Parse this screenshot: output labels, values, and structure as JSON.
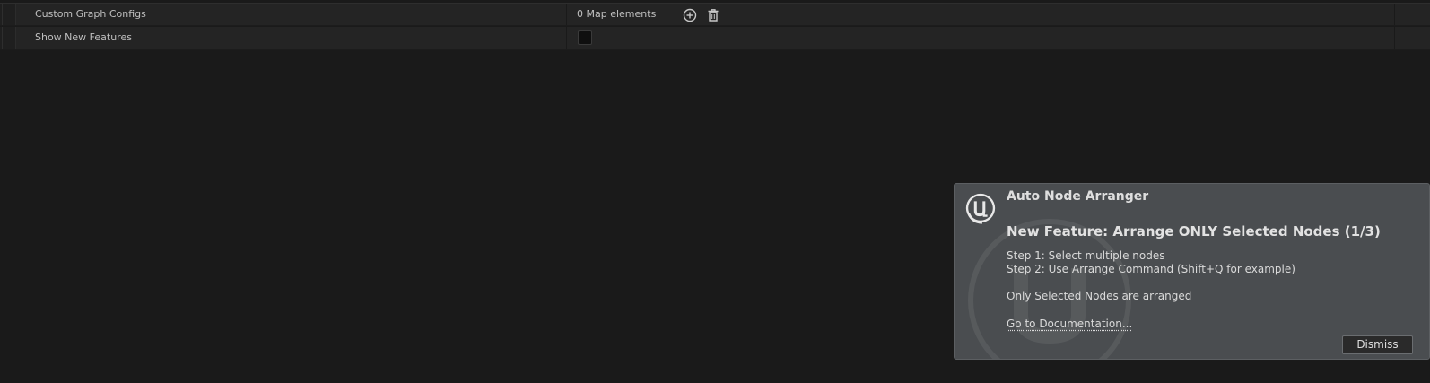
{
  "properties": {
    "rows": [
      {
        "label": "Custom Graph Configs",
        "value": "0 Map elements",
        "add_icon": "add-circle-icon",
        "delete_icon": "trash-icon"
      },
      {
        "label": "Show New Features",
        "checkbox_checked": false
      }
    ]
  },
  "notification": {
    "logo_icon": "unreal-engine-logo-icon",
    "title": "Auto Node Arranger",
    "heading": "New Feature: Arrange ONLY Selected Nodes (1/3)",
    "step1": "Step 1: Select multiple nodes",
    "step2": "Step 2: Use Arrange Command (Shift+Q for example)",
    "note": "Only Selected Nodes are arranged",
    "link": "Go to Documentation...",
    "dismiss_label": "Dismiss"
  },
  "colors": {
    "background": "#1a1a1a",
    "row_background": "#242424",
    "toast_background": "#4a4d50"
  }
}
